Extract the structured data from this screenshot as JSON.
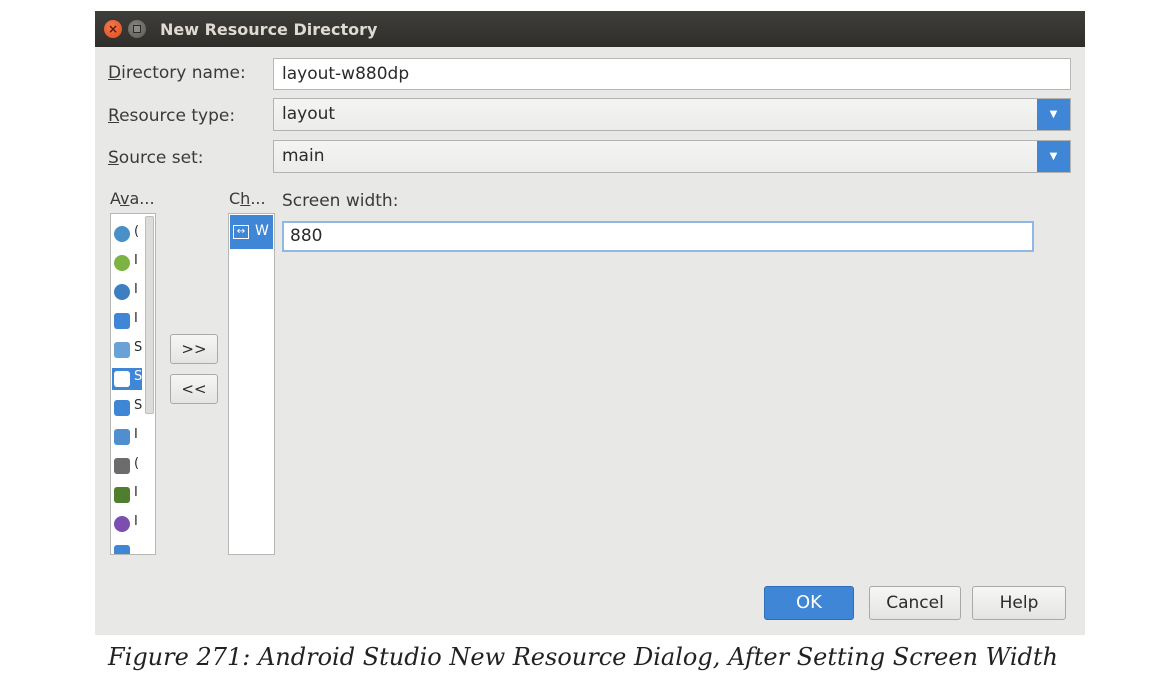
{
  "window": {
    "title": "New Resource Directory"
  },
  "form": {
    "directory_name": {
      "label": "Directory name:",
      "mnemonic": "D",
      "rest": "irectory name:",
      "value": "layout-w880dp"
    },
    "resource_type": {
      "label": "Resource type:",
      "mnemonic": "R",
      "rest": "esource type:",
      "value": "layout"
    },
    "source_set": {
      "label": "Source set:",
      "mnemonic": "S",
      "rest": "ource set:",
      "value": "main"
    }
  },
  "qualifiers": {
    "available_header": {
      "pre": "A",
      "mnemonic": "v",
      "post": "a..."
    },
    "chosen_header": {
      "pre": "C",
      "mnemonic": "h",
      "post": "..."
    },
    "available_items": [
      {
        "icon": "country-code-icon",
        "color": "#4a90c8",
        "text": "("
      },
      {
        "icon": "network-code-icon",
        "color": "#7cb342",
        "text": "I"
      },
      {
        "icon": "locale-globe-icon",
        "color": "#3d7fc1",
        "text": "I"
      },
      {
        "icon": "layout-direction-icon",
        "color": "#3f87d6",
        "text": "I"
      },
      {
        "icon": "smallest-width-icon",
        "color": "#6aa2d8",
        "text": "S"
      },
      {
        "icon": "screen-height-icon",
        "color": "#3f87d6",
        "text": "S",
        "selected": true
      },
      {
        "icon": "screen-size-icon",
        "color": "#3f87d6",
        "text": "S"
      },
      {
        "icon": "screen-ratio-icon",
        "color": "#4f8fcf",
        "text": "I"
      },
      {
        "icon": "orientation-icon",
        "color": "#6c6c6c",
        "text": "("
      },
      {
        "icon": "ui-mode-icon",
        "color": "#4e7e2e",
        "text": "I"
      },
      {
        "icon": "night-mode-icon",
        "color": "#7b4fb0",
        "text": "I"
      },
      {
        "icon": "density-icon",
        "color": "#3f87d6",
        "text": ""
      }
    ],
    "chosen_items": [
      {
        "icon": "screen-width-icon",
        "text": "W"
      }
    ],
    "add_button": ">>",
    "remove_button": "<<",
    "screen_width_label": "Screen width:",
    "screen_width_value": "880"
  },
  "buttons": {
    "ok": "OK",
    "cancel": "Cancel",
    "help": "Help"
  },
  "caption": "Figure 271: Android Studio New Resource Dialog, After Setting Screen Width"
}
